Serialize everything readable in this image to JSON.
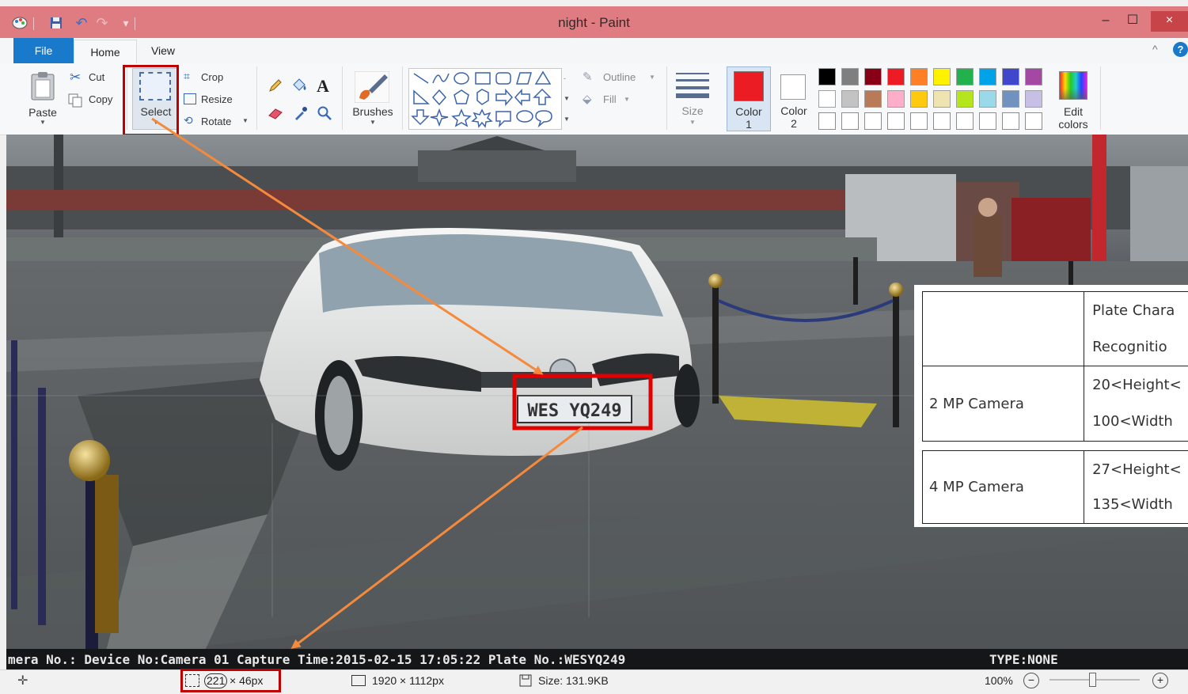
{
  "window": {
    "title": "night - Paint",
    "minimize": "–",
    "maximize": "☐",
    "close": "×"
  },
  "quick_access": {
    "undo": "↶",
    "redo": "↷",
    "customize": "▾"
  },
  "tabs": [
    {
      "label": "File"
    },
    {
      "label": "Home"
    },
    {
      "label": "View"
    }
  ],
  "ribbon": {
    "collapse": "^",
    "help": "?",
    "clipboard": {
      "paste": "Paste",
      "cut": "Cut",
      "copy": "Copy"
    },
    "image": {
      "select": "Select",
      "crop": "Crop",
      "resize": "Resize",
      "rotate": "Rotate"
    },
    "tools": {
      "text_tool": "A"
    },
    "brushes": "Brushes",
    "shapes": {
      "outline": "Outline",
      "fill": "Fill"
    },
    "size": "Size",
    "color1": {
      "label": "Color",
      "num": "1",
      "value": "#ec1c24"
    },
    "color2": {
      "label": "Color",
      "num": "2",
      "value": "#ffffff"
    },
    "edit_colors": [
      "Edit",
      "colors"
    ],
    "palette_row1": [
      "#000000",
      "#7f7f7f",
      "#880015",
      "#ed1c24",
      "#ff7f27",
      "#fff200",
      "#22b14c",
      "#00a2e8",
      "#3f48cc",
      "#a349a4"
    ],
    "palette_row2": [
      "#ffffff",
      "#c3c3c3",
      "#b97a57",
      "#ffaec9",
      "#ffc90e",
      "#efe4b0",
      "#b5e61d",
      "#99d9ea",
      "#7092be",
      "#c8bfe7"
    ],
    "palette_row3": [
      "#ffffff",
      "#ffffff",
      "#ffffff",
      "#ffffff",
      "#ffffff",
      "#ffffff",
      "#ffffff",
      "#ffffff",
      "#ffffff",
      "#ffffff"
    ],
    "highlight_color": "#c00000"
  },
  "photo": {
    "plate": "WES YQ249",
    "overlay_text": "mera No.: Device No:Camera 01 Capture Time:2015-02-15 17:05:22   Plate No.:WESYQ249",
    "overlay_type": "TYPE:NONE",
    "arrow_color": "#f58a3c"
  },
  "spec_table": {
    "header": [
      "Plate Chara",
      "Recognitio"
    ],
    "rows": [
      {
        "camera": "2 MP Camera",
        "lines": [
          "20<Height<",
          "100<Width"
        ]
      },
      {
        "camera": "4 MP Camera",
        "lines": [
          "27<Height<",
          "135<Width"
        ]
      }
    ]
  },
  "status": {
    "selection": [
      "221",
      "× 46px"
    ],
    "image_size": "1920 × 1112px",
    "file_size": "Size: 131.9KB",
    "zoom": "100%",
    "zoom_out": "−",
    "zoom_in": "+",
    "zoom_level": 1.0
  }
}
